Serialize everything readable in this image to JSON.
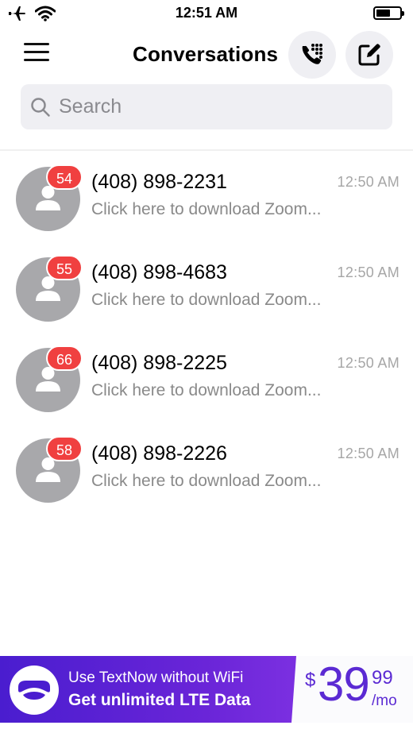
{
  "status_bar": {
    "time": "12:51 AM",
    "icons": [
      "airplane-icon",
      "wifi-icon",
      "battery-icon"
    ]
  },
  "header": {
    "title": "Conversations",
    "icons": {
      "menu": "hamburger-menu-icon",
      "dialer": "phone-keypad-icon",
      "compose": "compose-icon"
    }
  },
  "search": {
    "placeholder": "Search",
    "value": ""
  },
  "conversations": [
    {
      "badge": "54",
      "name": "(408) 898-2231",
      "time": "12:50 AM",
      "preview": "Click here to download Zoom..."
    },
    {
      "badge": "55",
      "name": "(408) 898-4683",
      "time": "12:50 AM",
      "preview": "Click here to download Zoom..."
    },
    {
      "badge": "66",
      "name": "(408) 898-2225",
      "time": "12:50 AM",
      "preview": "Click here to download Zoom..."
    },
    {
      "badge": "58",
      "name": "(408) 898-2226",
      "time": "12:50 AM",
      "preview": "Click here to download Zoom..."
    }
  ],
  "banner": {
    "line1": "Use TextNow without WiFi",
    "line2": "Get unlimited LTE Data",
    "price_currency": "$",
    "price_main": "39",
    "price_cents": "99",
    "price_unit": "/mo"
  },
  "colors": {
    "accent": "#5b2ad3",
    "badge": "#f04040",
    "avatar": "#a8a8ab"
  }
}
